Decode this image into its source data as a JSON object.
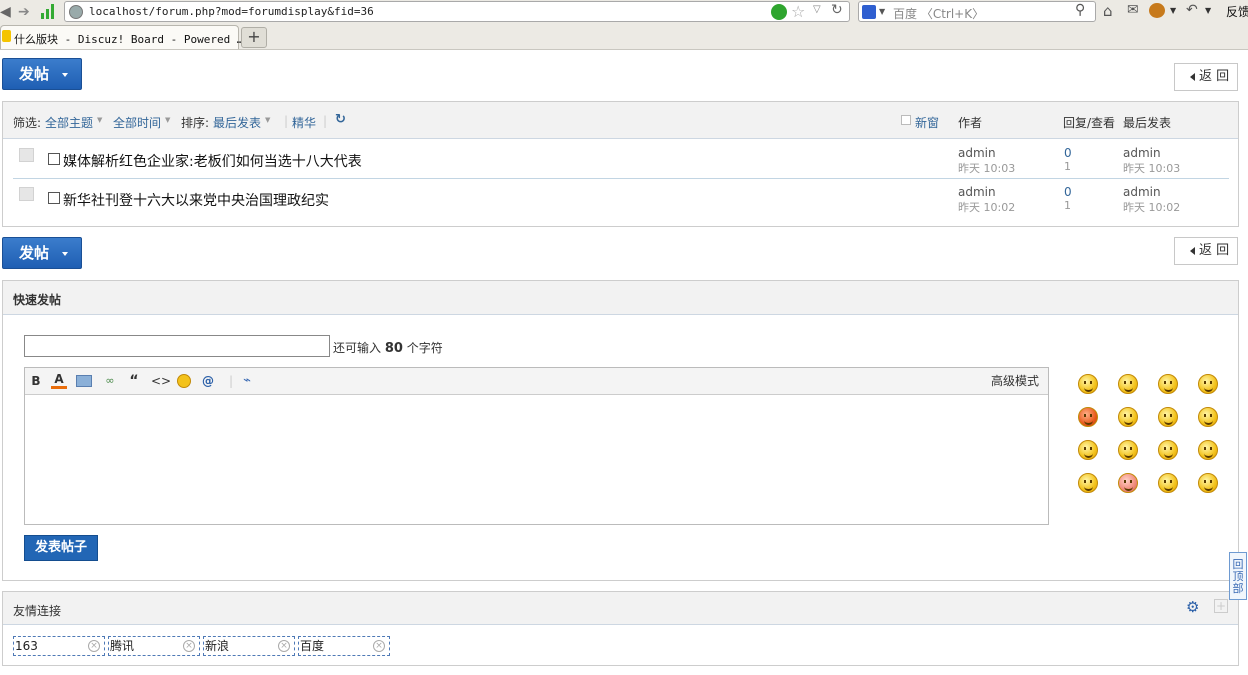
{
  "browser": {
    "url": "localhost/forum.php?mod=forumdisplay&fid=36",
    "search_placeholder": "百度 〈Ctrl+K〉",
    "tab_title": "什么版块 - Discuz! Board - Powered …",
    "new_tab": "+",
    "feedback": "反馈"
  },
  "toolbar": {
    "post_label": "发帖",
    "back_label": "返 回"
  },
  "filters": {
    "filter_label": "筛选:",
    "all_topics": "全部主题",
    "all_time": "全部时间",
    "sort_label": "排序:",
    "sort_value": "最后发表",
    "digest": "精华",
    "new_window": "新窗",
    "author": "作者",
    "replies_views": "回复/查看",
    "last_post": "最后发表"
  },
  "threads": [
    {
      "title": "媒体解析红色企业家:老板们如何当选十八大代表",
      "author": "admin",
      "author_time": "昨天 10:03",
      "replies": "0",
      "views": "1",
      "last_user": "admin",
      "last_time": "昨天 10:03"
    },
    {
      "title": "新华社刊登十六大以来党中央治国理政纪实",
      "author": "admin",
      "author_time": "昨天 10:02",
      "replies": "0",
      "views": "1",
      "last_user": "admin",
      "last_time": "昨天 10:02"
    }
  ],
  "quick_post": {
    "title": "快速发帖",
    "remaining_prefix": "还可输入",
    "remaining_count": "80",
    "remaining_suffix": "个字符",
    "advanced_mode": "高级模式",
    "submit": "发表帖子",
    "tools": {
      "bold": "B",
      "color": "A",
      "quote": "“",
      "code": "<>",
      "at": "@"
    }
  },
  "friend_links": {
    "title": "友情连接",
    "items": [
      "163",
      "腾讯",
      "新浪",
      "百度"
    ]
  },
  "back_to_top": "回顶部"
}
